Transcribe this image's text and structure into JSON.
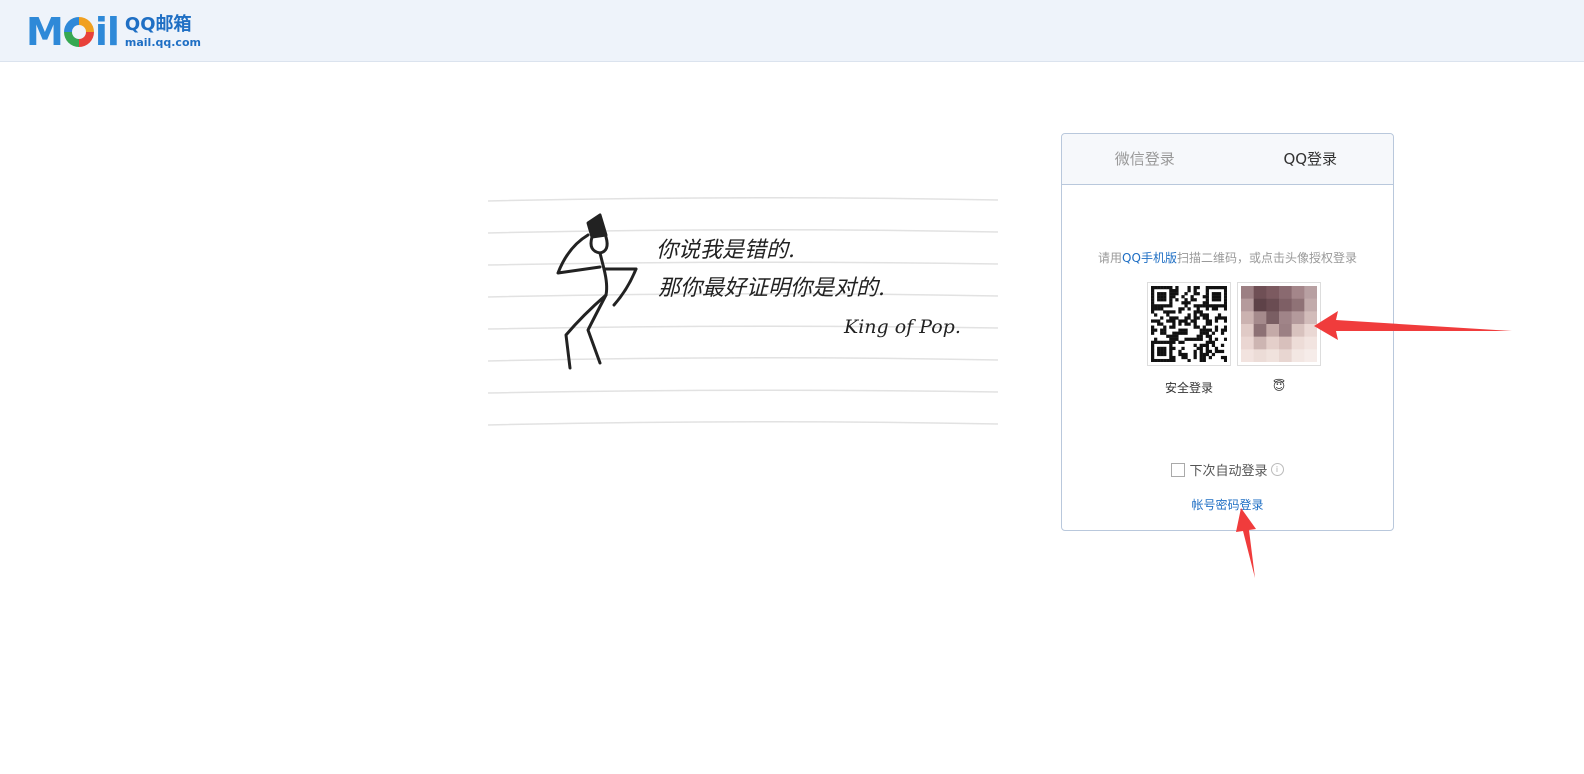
{
  "header": {
    "logo_mail": "Mil",
    "logo_cn": "QQ邮箱",
    "logo_en": "mail.qq.com"
  },
  "illustration": {
    "line1": "你说我是错的.",
    "line2": "那你最好证明你是对的.",
    "signature": "King of Pop."
  },
  "login_panel": {
    "tabs": [
      {
        "label": "微信登录",
        "active": false
      },
      {
        "label": "QQ登录",
        "active": true
      }
    ],
    "hint_prefix": "请用",
    "hint_link": "QQ手机版",
    "hint_suffix": "扫描二维码，或点击头像授权登录",
    "qr_caption": "安全登录",
    "avatar_caption": "😇",
    "auto_login_label": "下次自动登录",
    "password_login_link": "帐号密码登录"
  },
  "colors": {
    "accent": "#1f6fc4",
    "header_bg": "#eef3fa",
    "arrow": "#f03c3c"
  }
}
